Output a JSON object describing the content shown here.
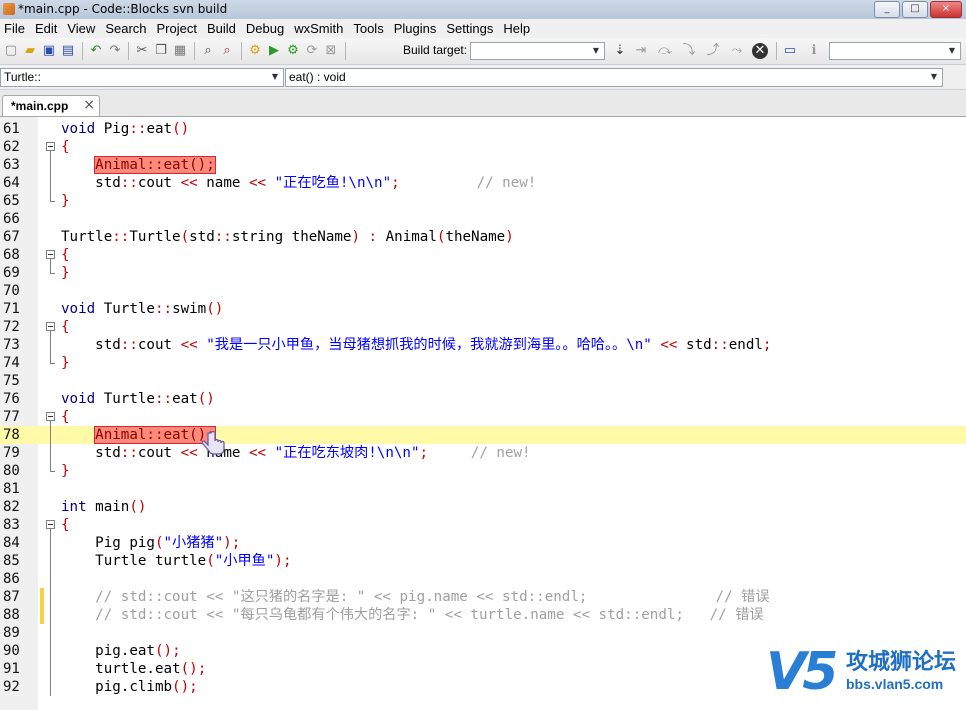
{
  "window": {
    "title": "*main.cpp - Code::Blocks svn build"
  },
  "menu": [
    "File",
    "Edit",
    "View",
    "Search",
    "Project",
    "Build",
    "Debug",
    "wxSmith",
    "Tools",
    "Plugins",
    "Settings",
    "Help"
  ],
  "toolbar": {
    "build_target_label": "Build target:",
    "build_target_value": ""
  },
  "code_completion": {
    "scope": "Turtle::",
    "function": "eat() : void"
  },
  "tabs": [
    {
      "label": "*main.cpp"
    }
  ],
  "editor": {
    "highlighted_line": 78,
    "lines": [
      {
        "n": "61",
        "text": "void Pig::eat()"
      },
      {
        "n": "62",
        "text": "{"
      },
      {
        "n": "63",
        "text": "    Animal::eat();"
      },
      {
        "n": "64",
        "text": "    std::cout << name << \"正在吃鱼!\\n\\n\";         // new!"
      },
      {
        "n": "65",
        "text": "}"
      },
      {
        "n": "66",
        "text": ""
      },
      {
        "n": "67",
        "text": "Turtle::Turtle(std::string theName) : Animal(theName)"
      },
      {
        "n": "68",
        "text": "{"
      },
      {
        "n": "69",
        "text": "}"
      },
      {
        "n": "70",
        "text": ""
      },
      {
        "n": "71",
        "text": "void Turtle::swim()"
      },
      {
        "n": "72",
        "text": "{"
      },
      {
        "n": "73",
        "text": "    std::cout << \"我是一只小甲鱼，当母猪想抓我的时候，我就游到海里。。哈哈。。\\n\" << std::endl;"
      },
      {
        "n": "74",
        "text": "}"
      },
      {
        "n": "75",
        "text": ""
      },
      {
        "n": "76",
        "text": "void Turtle::eat()"
      },
      {
        "n": "77",
        "text": "{"
      },
      {
        "n": "78",
        "text": "    Animal::eat();"
      },
      {
        "n": "79",
        "text": "    std::cout << name << \"正在吃东坡肉!\\n\\n\";     // new!"
      },
      {
        "n": "80",
        "text": "}"
      },
      {
        "n": "81",
        "text": ""
      },
      {
        "n": "82",
        "text": "int main()"
      },
      {
        "n": "83",
        "text": "{"
      },
      {
        "n": "84",
        "text": "    Pig pig(\"小猪猪\");"
      },
      {
        "n": "85",
        "text": "    Turtle turtle(\"小甲鱼\");"
      },
      {
        "n": "86",
        "text": ""
      },
      {
        "n": "87",
        "text": "    // std::cout << \"这只猪的名字是: \" << pig.name << std::endl;               // 错误"
      },
      {
        "n": "88",
        "text": "    // std::cout << \"每只乌龟都有个伟大的名字: \" << turtle.name << std::endl;   // 错误"
      },
      {
        "n": "89",
        "text": ""
      },
      {
        "n": "90",
        "text": "    pig.eat();"
      },
      {
        "n": "91",
        "text": "    turtle.eat();"
      },
      {
        "n": "92",
        "text": "    pig.climb();"
      }
    ]
  },
  "watermark": {
    "logo": "V5",
    "name": "攻城狮论坛",
    "url": "bbs.vlan5.com"
  }
}
